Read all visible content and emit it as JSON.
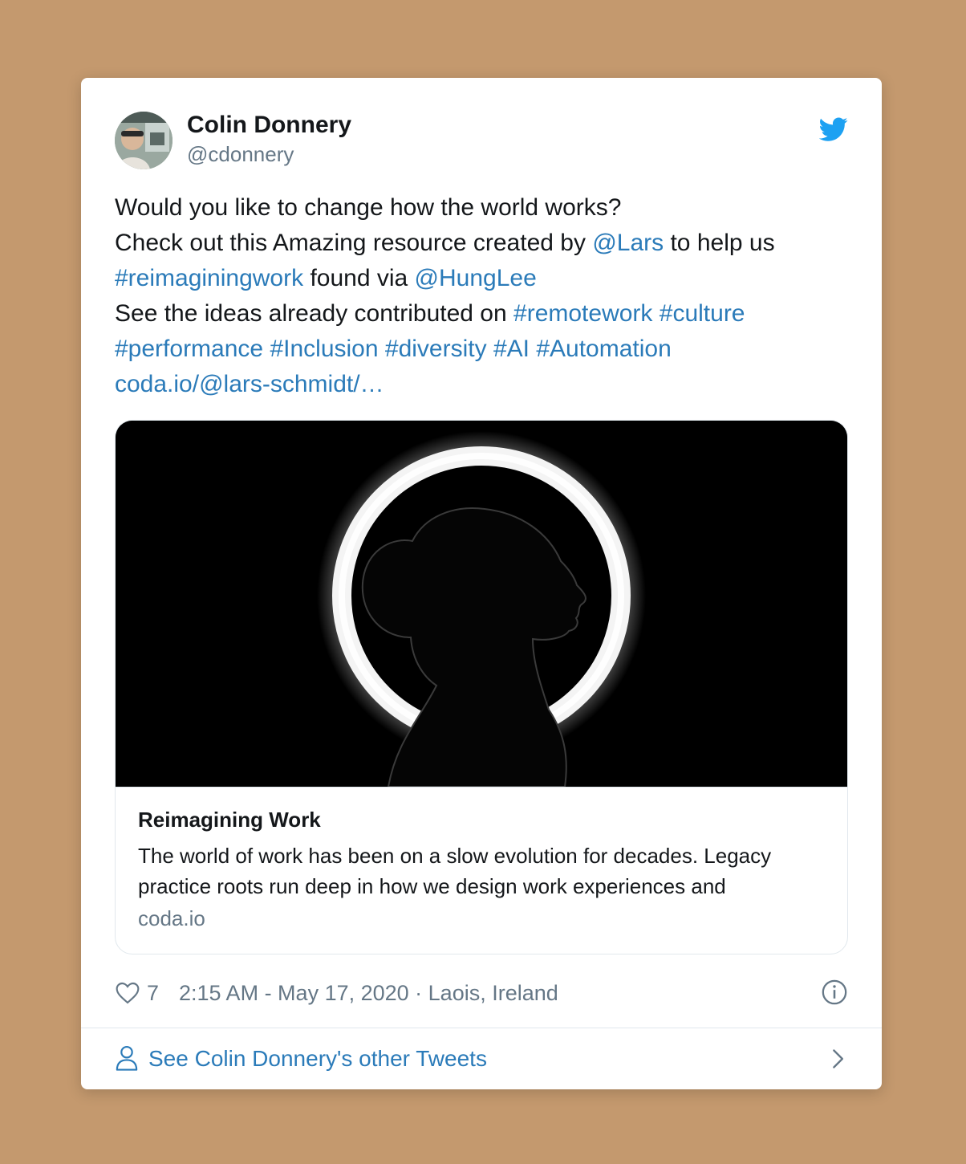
{
  "tweet": {
    "author": {
      "display_name": "Colin Donnery",
      "handle": "@cdonnery"
    },
    "text_lines": [
      [
        {
          "t": "Would you like to change how the world works?",
          "link": false
        }
      ],
      [
        {
          "t": "Check out this Amazing resource created by ",
          "link": false
        },
        {
          "t": "@Lars",
          "link": true
        },
        {
          "t": " to help us",
          "link": false
        }
      ],
      [
        {
          "t": "#reimaginingwork",
          "link": true
        },
        {
          "t": " found via  ",
          "link": false
        },
        {
          "t": "@HungLee",
          "link": true
        }
      ],
      [
        {
          "t": "See the ideas already contributed on ",
          "link": false
        },
        {
          "t": "#remotework",
          "link": true
        },
        {
          "t": " ",
          "link": false
        },
        {
          "t": "#culture",
          "link": true
        }
      ],
      [
        {
          "t": "#performance",
          "link": true
        },
        {
          "t": " ",
          "link": false
        },
        {
          "t": "#Inclusion",
          "link": true
        },
        {
          "t": " ",
          "link": false
        },
        {
          "t": "#diversity",
          "link": true
        },
        {
          "t": " ",
          "link": false
        },
        {
          "t": "#AI",
          "link": true
        },
        {
          "t": " ",
          "link": false
        },
        {
          "t": "#Automation",
          "link": true
        }
      ],
      [
        {
          "t": "coda.io/@lars-schmidt/…",
          "link": true
        }
      ]
    ],
    "card": {
      "title": "Reimagining Work",
      "description": "The world of work has been on a slow evolution for decades. Legacy practice roots run deep in how we design work experiences and",
      "domain": "coda.io"
    },
    "likes": "7",
    "timestamp": "2:15 AM - May 17, 2020 · Laois, Ireland",
    "footer_link": "See Colin Donnery's other Tweets"
  },
  "icons": {
    "brand": "twitter-bird-icon",
    "like": "heart-icon",
    "info": "info-icon",
    "profile": "person-icon",
    "more": "chevron-right-icon"
  },
  "colors": {
    "background": "#c4996e",
    "link": "#2b7bb9",
    "twitter_blue": "#1da1f2",
    "muted": "#657786"
  }
}
